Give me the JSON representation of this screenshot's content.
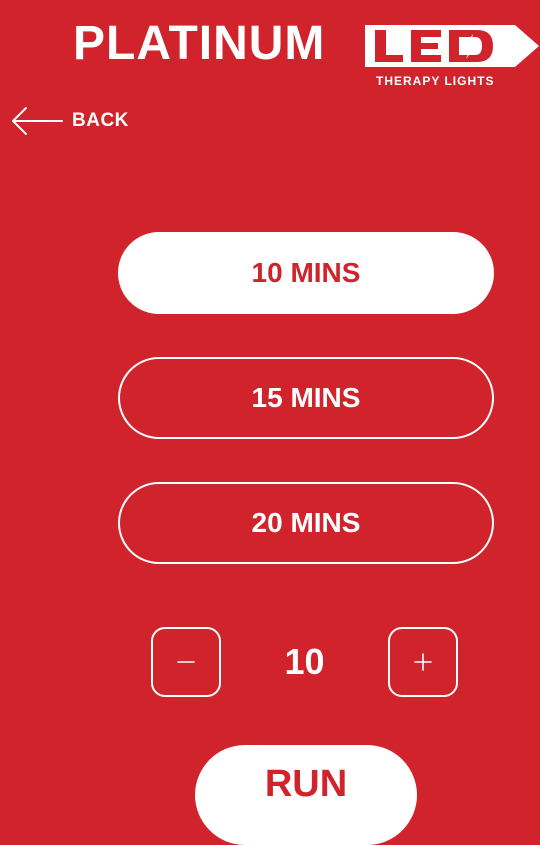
{
  "colors": {
    "background": "#d0232b",
    "foreground": "#ffffff",
    "selected_text": "#d0232b"
  },
  "logo": {
    "word": "PLATINUM",
    "badge_text": "LED",
    "tagline": "THERAPY LIGHTS"
  },
  "nav": {
    "back_label": "BACK",
    "back_icon": "arrow-left-icon"
  },
  "options": [
    {
      "label": "10 MINS",
      "selected": true
    },
    {
      "label": "15 MINS",
      "selected": false
    },
    {
      "label": "20 MINS",
      "selected": false
    }
  ],
  "stepper": {
    "value": "10",
    "minus_symbol": "−",
    "plus_symbol": "+",
    "minus_icon": "minus-icon",
    "plus_icon": "plus-icon"
  },
  "actions": {
    "run_label": "RUN"
  }
}
